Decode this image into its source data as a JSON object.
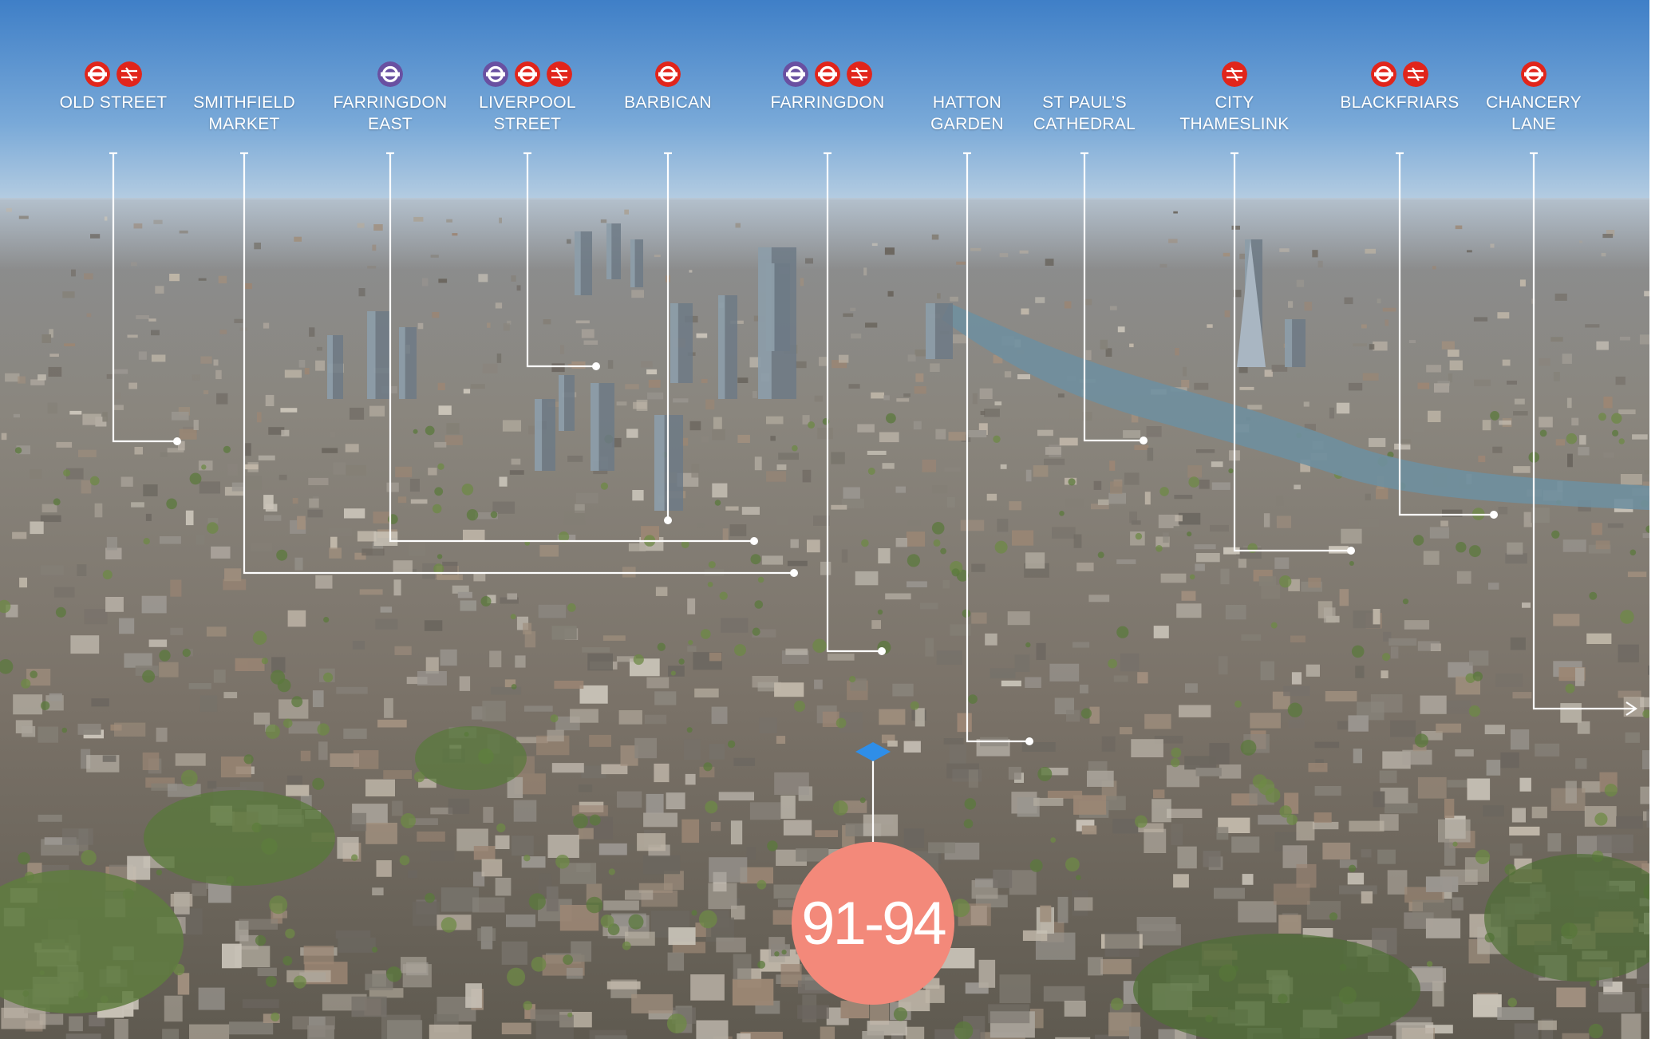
{
  "colors": {
    "underground": "#e1251b",
    "elizabeth_line": "#6950a1",
    "national_rail": "#e1251b",
    "badge": "#f3897a",
    "lines": "#ffffff"
  },
  "stations": [
    {
      "id": "old-street",
      "lines": [
        "OLD STREET"
      ],
      "icons": [
        "underground-roundel-icon",
        "national-rail-icon"
      ]
    },
    {
      "id": "smithfield-market",
      "lines": [
        "SMITHFIELD",
        "MARKET"
      ],
      "icons": []
    },
    {
      "id": "farringdon-east",
      "lines": [
        "FARRINGDON",
        "EAST"
      ],
      "icons": [
        "elizabeth-line-roundel-icon"
      ]
    },
    {
      "id": "liverpool-street",
      "lines": [
        "LIVERPOOL",
        "STREET"
      ],
      "icons": [
        "elizabeth-line-roundel-icon",
        "underground-roundel-icon",
        "national-rail-icon"
      ]
    },
    {
      "id": "barbican",
      "lines": [
        "BARBICAN"
      ],
      "icons": [
        "underground-roundel-icon"
      ]
    },
    {
      "id": "farringdon",
      "lines": [
        "FARRINGDON"
      ],
      "icons": [
        "elizabeth-line-roundel-icon",
        "underground-roundel-icon",
        "national-rail-icon"
      ]
    },
    {
      "id": "hatton-garden",
      "lines": [
        "HATTON",
        "GARDEN"
      ],
      "icons": []
    },
    {
      "id": "st-pauls-cathedral",
      "lines": [
        "ST PAUL’S",
        "CATHEDRAL"
      ],
      "icons": []
    },
    {
      "id": "city-thameslink",
      "lines": [
        "CITY",
        "THAMESLINK"
      ],
      "icons": [
        "national-rail-icon"
      ]
    },
    {
      "id": "blackfriars",
      "lines": [
        "BLACKFRIARS"
      ],
      "icons": [
        "underground-roundel-icon",
        "national-rail-icon"
      ]
    },
    {
      "id": "chancery-lane",
      "lines": [
        "CHANCERY",
        "LANE"
      ],
      "icons": [
        "underground-roundel-icon"
      ]
    }
  ],
  "badge": {
    "label": "91-94"
  }
}
